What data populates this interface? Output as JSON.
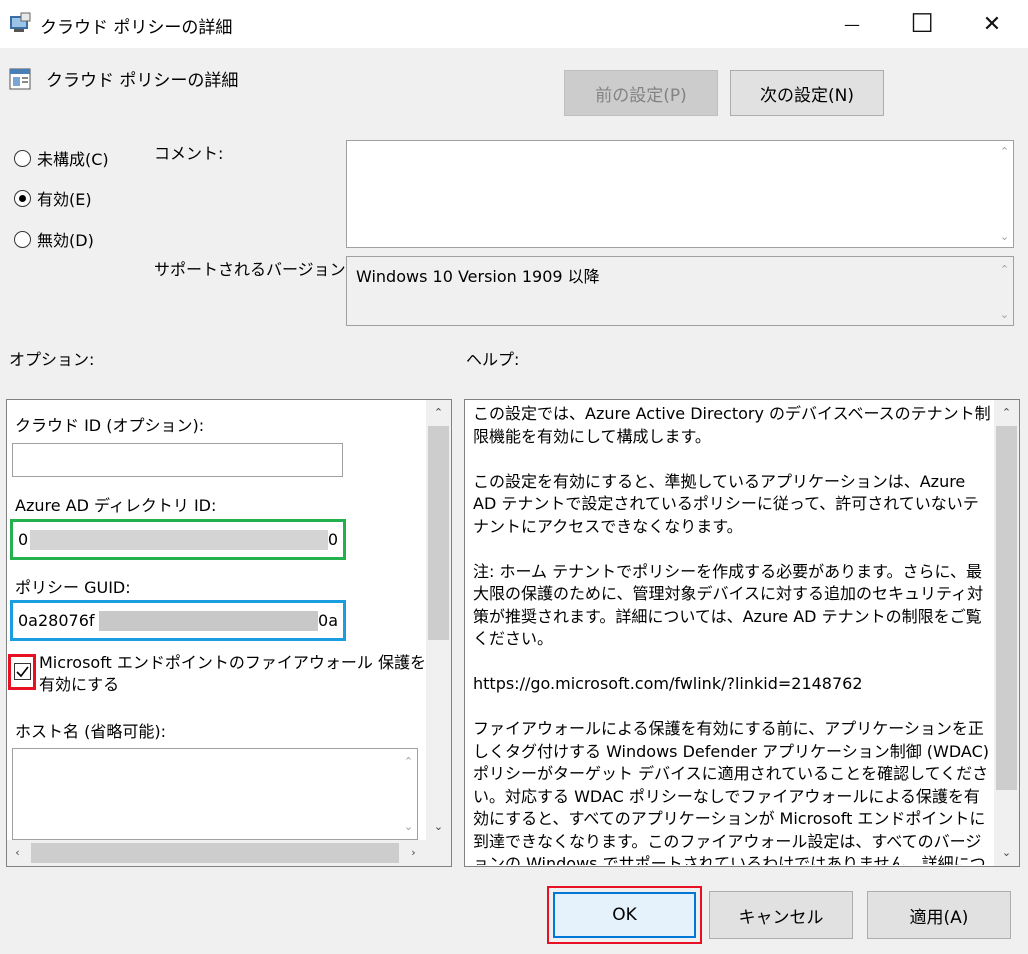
{
  "window": {
    "title": "クラウド ポリシーの詳細",
    "minimize_glyph": "—",
    "maximize_glyph": "☐",
    "close_glyph": "✕"
  },
  "header": {
    "setting_name": "クラウド ポリシーの詳細",
    "prev_button": "前の設定(P)",
    "next_button": "次の設定(N)"
  },
  "state": {
    "options": [
      {
        "label": "未構成(C)",
        "selected": false
      },
      {
        "label": "有効(E)",
        "selected": true
      },
      {
        "label": "無効(D)",
        "selected": false
      }
    ]
  },
  "comment": {
    "label": "コメント:",
    "value": ""
  },
  "supported": {
    "label": "サポートされるバージョン:",
    "value": "Windows 10 Version 1909 以降"
  },
  "options_section": {
    "label": "オプション:",
    "cloud_id_label": "クラウド ID (オプション):",
    "cloud_id_value": "",
    "aad_dir_label": "Azure AD ディレクトリ ID:",
    "aad_dir_value": "0",
    "aad_dir_value_tail": "0",
    "guid_label": "ポリシー GUID:",
    "guid_value_prefix": "0a28076f",
    "guid_value_suffix": "0a",
    "checkbox_label_line1": "Microsoft エンドポイントのファイアウォール 保護を",
    "checkbox_label_line2": "有効にする",
    "checkbox_checked": true,
    "hostname_label": "ホスト名 (省略可能):",
    "hostname_value": ""
  },
  "help_section": {
    "label": "ヘルプ:",
    "paragraphs": [
      "この設定では、Azure Active Directory のデバイスベースのテナント制限機能を有効にして構成します。",
      "この設定を有効にすると、準拠しているアプリケーションは、Azure AD テナントで設定されているポリシーに従って、許可されていないテナントにアクセスできなくなります。",
      "注: ホーム テナントでポリシーを作成する必要があります。さらに、最大限の保護のために、管理対象デバイスに対する追加のセキュリティ対策が推奨されます。詳細については、Azure AD テナントの制限をご覧ください。",
      "https://go.microsoft.com/fwlink/?linkid=2148762",
      "ファイアウォールによる保護を有効にする前に、アプリケーションを正しくタグ付けする Windows Defender アプリケーション制御 (WDAC) ポリシーがターゲット デバイスに適用されていることを確認してください。対応する WDAC ポリシーなしでファイアウォールによる保護を有効にすると、すべてのアプリケーションが Microsoft エンドポイントに到達できなくなります。このファイアウォール設定は、すべてのバージョンの Windows でサポートされているわけではありません。詳細については、以下のリンクをご覧ください。テナント制限を使用した WDAC の設定の詳細については"
    ]
  },
  "footer": {
    "ok": "OK",
    "cancel": "キャンセル",
    "apply": "適用(A)"
  },
  "colors": {
    "highlight_green": "#22b14c",
    "highlight_blue": "#1a9ee0",
    "highlight_red": "#e81123",
    "focus_blue": "#0078d7"
  }
}
